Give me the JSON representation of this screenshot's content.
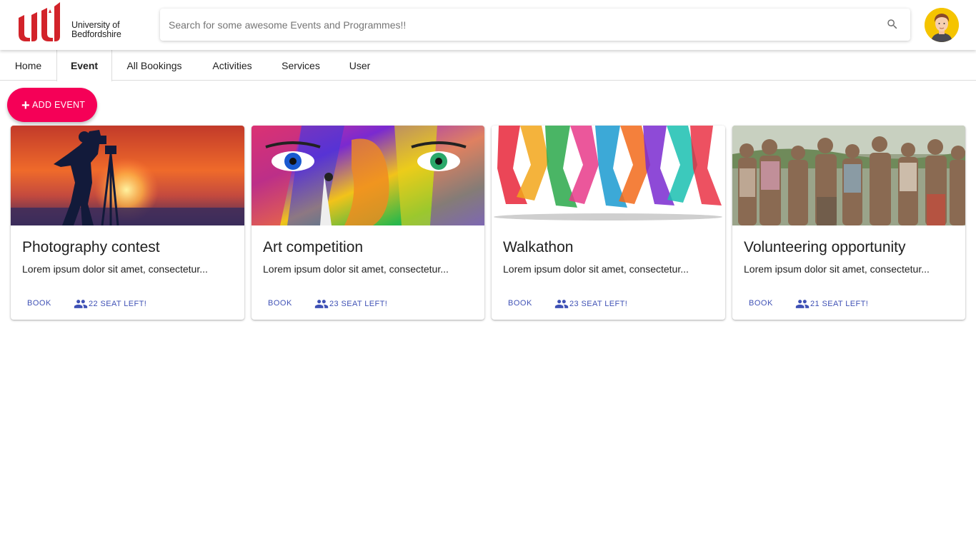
{
  "header": {
    "logo_text_line1": "University of",
    "logo_text_line2": "Bedfordshire",
    "search_placeholder": "Search for some awesome Events and Programmes!!",
    "search_icon": "search-icon",
    "avatar": "user-avatar"
  },
  "tabs": [
    {
      "label": "Home",
      "active": false
    },
    {
      "label": "Event",
      "active": true
    },
    {
      "label": "All Bookings",
      "active": false
    },
    {
      "label": "Activities",
      "active": false
    },
    {
      "label": "Services",
      "active": false
    },
    {
      "label": "User",
      "active": false
    }
  ],
  "add_button": {
    "label": "ADD EVENT",
    "icon": "plus-icon"
  },
  "colors": {
    "accent": "#f50057",
    "primary": "#3f51b5",
    "brand_red": "#d2232a"
  },
  "cards": [
    {
      "title": "Photography contest",
      "description": "Lorem ipsum dolor sit amet, consectetur...",
      "book_label": "BOOK",
      "seats_label": "22 SEAT LEFT!",
      "image": "photographer-silhouette-sunset"
    },
    {
      "title": "Art competition",
      "description": "Lorem ipsum dolor sit amet, consectetur...",
      "book_label": "BOOK",
      "seats_label": "23 SEAT LEFT!",
      "image": "colorful-painted-face"
    },
    {
      "title": "Walkathon",
      "description": "Lorem ipsum dolor sit amet, consectetur...",
      "book_label": "BOOK",
      "seats_label": "23 SEAT LEFT!",
      "image": "colorful-running-legs"
    },
    {
      "title": "Volunteering opportunity",
      "description": "Lorem ipsum dolor sit amet, consectetur...",
      "book_label": "BOOK",
      "seats_label": "21 SEAT LEFT!",
      "image": "muddy-volunteers-group"
    }
  ]
}
